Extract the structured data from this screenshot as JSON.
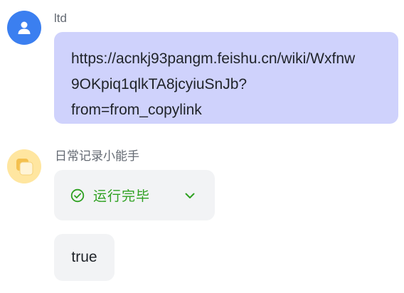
{
  "user_message": {
    "sender": "ltd",
    "avatar_icon": "person-icon",
    "text_line1": "https://acnkj93pangm.feishu.cn/wiki/Wxfnw",
    "text_line2": "9OKpiq1qlkTA8jcyiuSnJb?",
    "text_line3": "from=from_copylink"
  },
  "bot_message": {
    "sender": "日常记录小能手",
    "avatar_icon": "bot-logo-icon",
    "status_text": "运行完毕",
    "status_icon": "check-circle-icon",
    "expand_icon": "chevron-down-icon",
    "result_text": "true"
  },
  "colors": {
    "user_avatar": "#3b7ff0",
    "user_bubble": "#cfd2fc",
    "bot_avatar": "#ffe9a8",
    "card_background": "#f2f3f5",
    "success_green": "#2ea121"
  }
}
